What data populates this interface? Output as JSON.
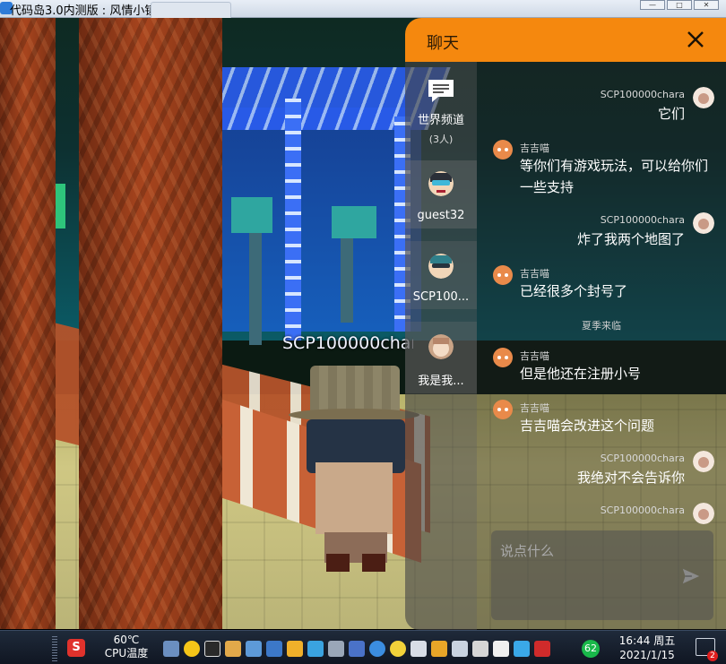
{
  "window": {
    "title": "代码岛3.0内测版 : 风情小镇",
    "controls": [
      "—",
      "□",
      "✕"
    ]
  },
  "scene": {
    "player_nametag": "SCP100000chara"
  },
  "chat": {
    "title": "聊天",
    "close_icon": "close-icon",
    "channels": [
      {
        "label": "世界频道",
        "sub": "(3人)",
        "icon": "chat-bubble-icon"
      },
      {
        "label": "guest32",
        "icon": "avatar-goggles"
      },
      {
        "label": "SCP100...",
        "icon": "avatar-teal-hair"
      },
      {
        "label": "我是我...",
        "icon": "avatar-girl"
      }
    ],
    "messages": [
      {
        "side": "right",
        "name": "SCP100000chara",
        "text": "它们"
      },
      {
        "side": "left",
        "name": "吉吉喵",
        "text": "等你们有游戏玩法，可以给你们一些支持"
      },
      {
        "side": "right",
        "name": "SCP100000chara",
        "text": "炸了我两个地图了"
      },
      {
        "side": "left",
        "name": "吉吉喵",
        "text": "已经很多个封号了"
      },
      {
        "side": "system",
        "text": "夏季来临"
      },
      {
        "side": "left",
        "name": "吉吉喵",
        "text": "但是他还在注册小号"
      },
      {
        "side": "left",
        "name": "吉吉喵",
        "text": "吉吉喵会改进这个问题"
      },
      {
        "side": "right",
        "name": "SCP100000chara",
        "text": "我绝对不会告诉你"
      },
      {
        "side": "right",
        "name": "SCP100000chara",
        "text": ""
      }
    ],
    "input": {
      "placeholder": "说点什么",
      "value": ""
    },
    "send_icon": "send-icon"
  },
  "taskbar": {
    "temp_value": "60℃",
    "temp_label": "CPU温度",
    "badge": "62",
    "time": "16:44 周五",
    "date": "2021/1/15",
    "notification_count": "2"
  },
  "colors": {
    "chat_header": "#f5880e",
    "taskbar": "#101622"
  }
}
